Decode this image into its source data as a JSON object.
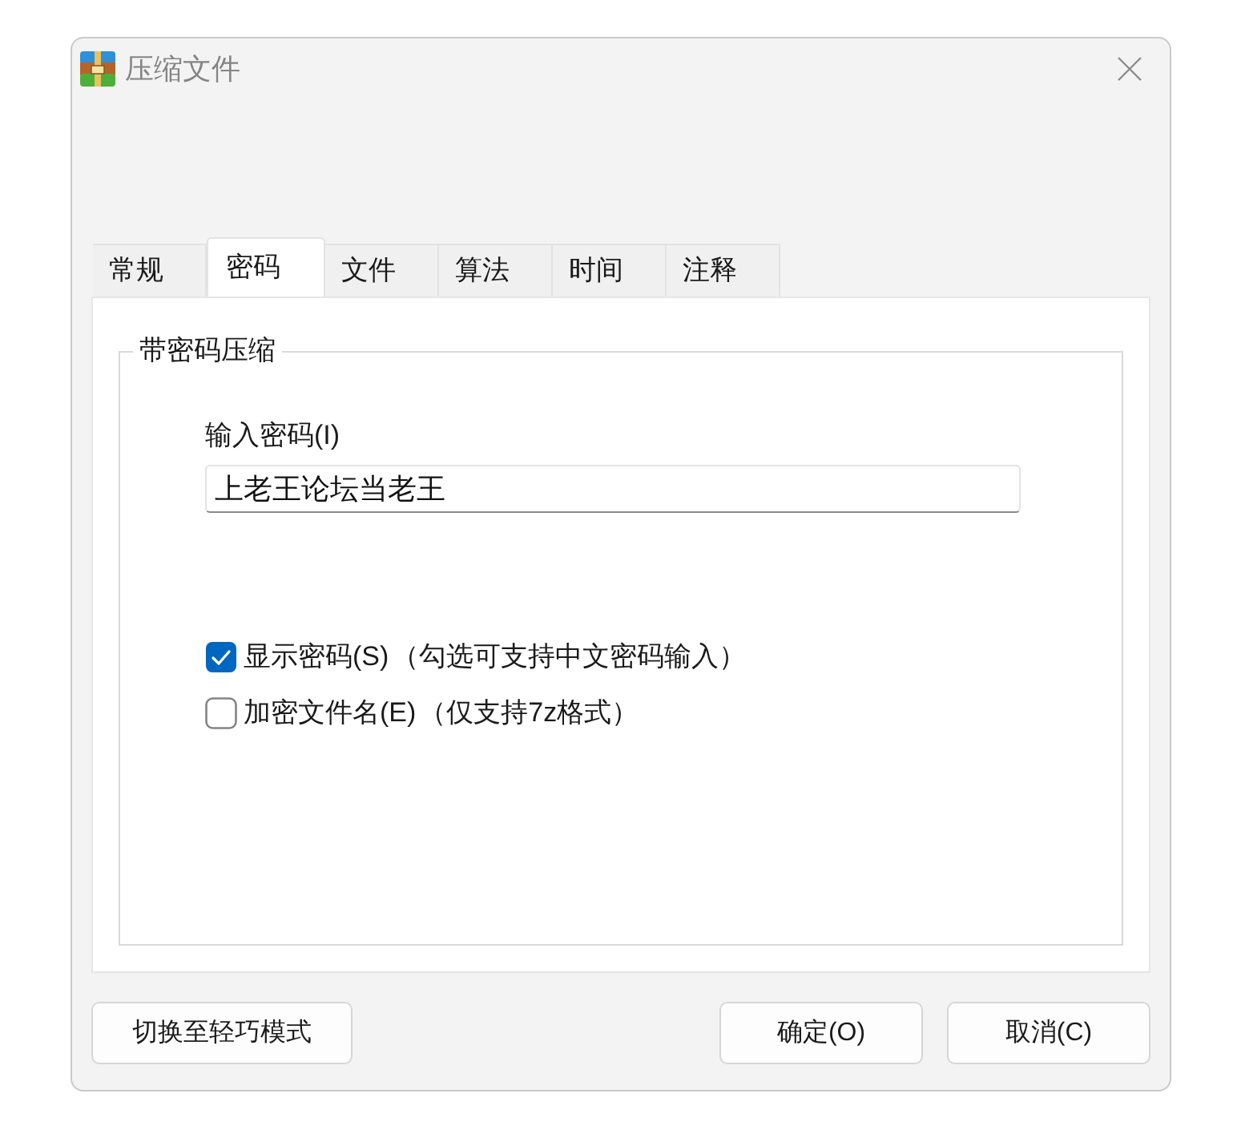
{
  "window": {
    "title": "压缩文件"
  },
  "tabs": [
    {
      "label": "常规",
      "selected": false
    },
    {
      "label": "密码",
      "selected": true
    },
    {
      "label": "文件",
      "selected": false
    },
    {
      "label": "算法",
      "selected": false
    },
    {
      "label": "时间",
      "selected": false
    },
    {
      "label": "注释",
      "selected": false
    }
  ],
  "group": {
    "title": "带密码压缩",
    "password": {
      "label": "输入密码(I)",
      "value": "上老王论坛当老王"
    },
    "options": [
      {
        "label": "显示密码(S)",
        "note": "（勾选可支持中文密码输入）",
        "checked": true
      },
      {
        "label": "加密文件名(E)",
        "note": "（仅支持7z格式）",
        "checked": false
      }
    ]
  },
  "buttons": [
    {
      "label": "切换至轻巧模式",
      "kind": "toggle"
    },
    {
      "label": "确定(O)",
      "kind": "confirm"
    },
    {
      "label": "取消(C)",
      "kind": "cancel"
    }
  ]
}
